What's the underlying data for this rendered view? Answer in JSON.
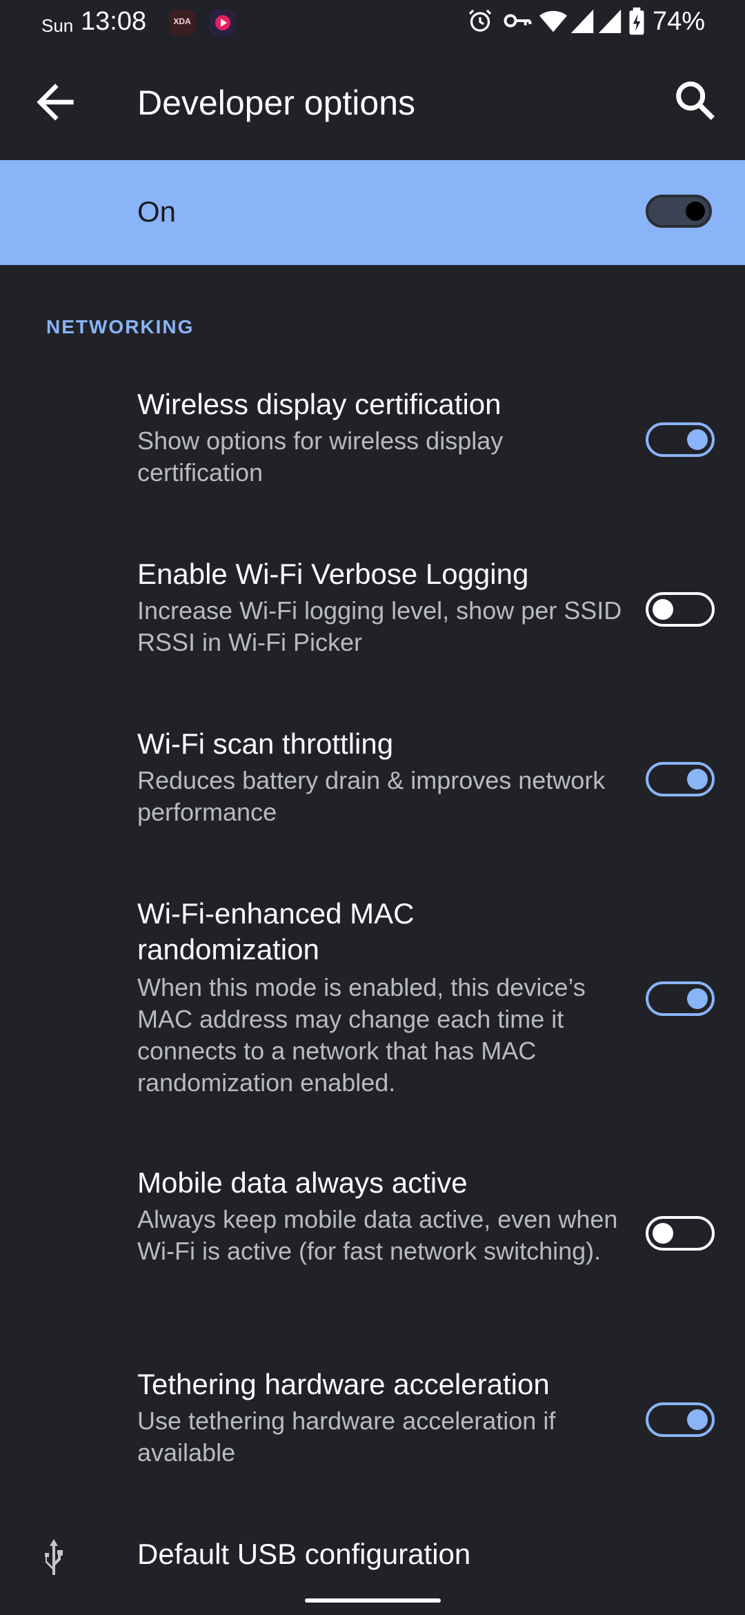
{
  "status_bar": {
    "day": "Sun",
    "time": "13:08",
    "app_badge_1": "XDA",
    "battery_percent": "74%",
    "icons": [
      "alarm-icon",
      "vpn-key-icon",
      "wifi-icon",
      "signal-icon",
      "signal-icon",
      "battery-charging-icon"
    ]
  },
  "app_bar": {
    "title": "Developer options",
    "back_icon": "arrow-back-icon",
    "search_icon": "search-icon"
  },
  "master_switch": {
    "label": "On",
    "checked": true
  },
  "section": {
    "header": "NETWORKING"
  },
  "preferences": [
    {
      "title": "Wireless display certification",
      "summary": "Show options for wireless display certification",
      "checked": true
    },
    {
      "title": "Enable Wi-Fi Verbose Logging",
      "summary": "Increase Wi-Fi logging level, show per SSID RSSI in Wi-Fi Picker",
      "checked": false
    },
    {
      "title": "Wi-Fi scan throttling",
      "summary": "Reduces battery drain & improves network performance",
      "checked": true
    },
    {
      "title": "Wi-Fi-enhanced MAC randomization",
      "summary": "When this mode is enabled, this device’s MAC address may change each time it connects to a network that has MAC randomization enabled.",
      "checked": true
    },
    {
      "title": "Mobile data always active",
      "summary": "Always keep mobile data active, even when Wi-Fi is active (for fast network switching).",
      "checked": false
    },
    {
      "title": "Tethering hardware acceleration",
      "summary": "Use tethering hardware acceleration if available",
      "checked": true
    }
  ],
  "usb": {
    "title": "Default USB configuration",
    "icon": "usb-icon"
  },
  "colors": {
    "background": "#212227",
    "accent": "#8ab4f8",
    "summary_text": "#b9bbc2"
  }
}
